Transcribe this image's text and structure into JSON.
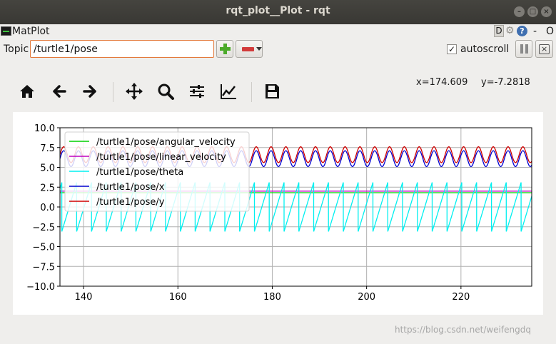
{
  "window": {
    "title": "rqt_plot__Plot - rqt",
    "min_glyph": "–",
    "max_glyph": "□",
    "close_glyph": "×"
  },
  "plugin": {
    "name": "MatPlot",
    "icons": [
      "matplot-icon",
      "d-icon",
      "gear-icon",
      "help-icon",
      "dash-icon",
      "o-icon"
    ],
    "d_label": "D",
    "help_label": "?",
    "dash_label": "-",
    "o_label": "O"
  },
  "topic": {
    "label": "Topic",
    "value": "/turtle1/pose"
  },
  "autoscroll": {
    "label": "autoscroll",
    "checked": true,
    "check_glyph": "✓"
  },
  "toolbar": {
    "icons": [
      "home-icon",
      "back-icon",
      "forward-icon",
      "pan-icon",
      "zoom-icon",
      "configure-icon",
      "edit-curves-icon",
      "save-icon"
    ],
    "x_readout": "x=174.609",
    "y_readout": "y=-7.2818"
  },
  "chart_data": {
    "type": "line",
    "xlim": [
      135,
      235
    ],
    "ylim": [
      -10.0,
      10.0
    ],
    "xticks": [
      140,
      160,
      180,
      200,
      220
    ],
    "yticks": [
      "10.0",
      "7.5",
      "5.0",
      "2.5",
      "0.0",
      "−2.5",
      "−5.0",
      "−7.5",
      "−10.0"
    ],
    "ytick_values": [
      10.0,
      7.5,
      5.0,
      2.5,
      0.0,
      -2.5,
      -5.0,
      -7.5,
      -10.0
    ],
    "grid": true,
    "legend_position": "upper-left",
    "series": [
      {
        "name": "/turtle1/pose/angular_velocity",
        "color": "#00d000",
        "kind": "constant",
        "value": 1.8
      },
      {
        "name": "/turtle1/pose/linear_velocity",
        "color": "#c000c0",
        "kind": "constant",
        "value": 2.0
      },
      {
        "name": "/turtle1/pose/theta",
        "color": "#00f0f0",
        "kind": "sawtooth",
        "min": -3.1,
        "max": 3.1,
        "period": 3.14
      },
      {
        "name": "/turtle1/pose/x",
        "color": "#0000d0",
        "kind": "sine",
        "center": 6.1,
        "amplitude": 1.0,
        "period": 3.14
      },
      {
        "name": "/turtle1/pose/y",
        "color": "#d00000",
        "kind": "sine",
        "center": 6.6,
        "amplitude": 1.0,
        "period": 3.14
      }
    ]
  },
  "watermark": "https://blog.csdn.net/weifengdq"
}
